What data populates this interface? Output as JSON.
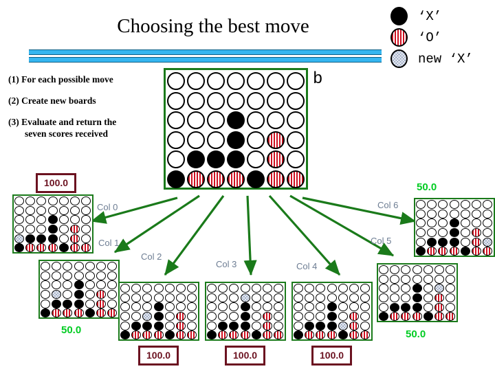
{
  "slide": {
    "title": "Choosing the best move",
    "board_label": "b"
  },
  "steps": [
    {
      "num": "(1)",
      "text": "For each possible move",
      "cont": ""
    },
    {
      "num": "(2)",
      "text": "Create new boards",
      "cont": ""
    },
    {
      "num": "(3)",
      "text": "Evaluate and return the",
      "cont": "seven scores received"
    }
  ],
  "legend": {
    "items": [
      {
        "icon": "black-disc-icon",
        "kind": "x",
        "label": "‘X’"
      },
      {
        "icon": "striped-disc-icon",
        "kind": "o",
        "label": "‘O’"
      },
      {
        "icon": "hatched-disc-icon",
        "kind": "new",
        "label": "new ‘X’"
      }
    ]
  },
  "colors": {
    "board_border": "#1a7a1a",
    "arrow": "#1a7a1a",
    "score_box_border": "#6b1220",
    "score_box_text": "#6b1220",
    "score_green": "#00cc22",
    "col_label": "#6d7d93",
    "rule_fill": "#35b6f0",
    "piece_x": "#000000",
    "piece_o": "#cf1020",
    "piece_new": "#9aa9c4"
  },
  "main_board": {
    "rows": 6,
    "cols": 7,
    "legend_key": {
      "e": "empty",
      "x": "black 'X'",
      "o": "red striped 'O'",
      "n": "new 'X'"
    },
    "grid": [
      [
        "e",
        "e",
        "e",
        "e",
        "e",
        "e",
        "e"
      ],
      [
        "e",
        "e",
        "e",
        "e",
        "e",
        "e",
        "e"
      ],
      [
        "e",
        "e",
        "e",
        "x",
        "e",
        "e",
        "e"
      ],
      [
        "e",
        "e",
        "e",
        "x",
        "e",
        "o",
        "e"
      ],
      [
        "e",
        "x",
        "x",
        "x",
        "e",
        "o",
        "e"
      ],
      [
        "x",
        "o",
        "o",
        "o",
        "x",
        "o",
        "o"
      ]
    ]
  },
  "branches": [
    {
      "id": "col0",
      "col_label": "Col 0",
      "score": "100.0",
      "score_style": "box",
      "score_position": "above",
      "grid": [
        [
          "e",
          "e",
          "e",
          "e",
          "e",
          "e",
          "e"
        ],
        [
          "e",
          "e",
          "e",
          "e",
          "e",
          "e",
          "e"
        ],
        [
          "e",
          "e",
          "e",
          "x",
          "e",
          "e",
          "e"
        ],
        [
          "e",
          "e",
          "e",
          "x",
          "e",
          "o",
          "e"
        ],
        [
          "n",
          "x",
          "x",
          "x",
          "e",
          "o",
          "e"
        ],
        [
          "x",
          "o",
          "o",
          "o",
          "x",
          "o",
          "o"
        ]
      ]
    },
    {
      "id": "col1",
      "col_label": "Col 1",
      "score": "50.0",
      "score_style": "green",
      "score_position": "below",
      "grid": [
        [
          "e",
          "e",
          "e",
          "e",
          "e",
          "e",
          "e"
        ],
        [
          "e",
          "e",
          "e",
          "e",
          "e",
          "e",
          "e"
        ],
        [
          "e",
          "e",
          "e",
          "x",
          "e",
          "e",
          "e"
        ],
        [
          "e",
          "n",
          "e",
          "x",
          "e",
          "o",
          "e"
        ],
        [
          "e",
          "x",
          "x",
          "x",
          "e",
          "o",
          "e"
        ],
        [
          "x",
          "o",
          "o",
          "o",
          "x",
          "o",
          "o"
        ]
      ]
    },
    {
      "id": "col2",
      "col_label": "Col 2",
      "score": "100.0",
      "score_style": "box",
      "score_position": "below",
      "grid": [
        [
          "e",
          "e",
          "e",
          "e",
          "e",
          "e",
          "e"
        ],
        [
          "e",
          "e",
          "e",
          "e",
          "e",
          "e",
          "e"
        ],
        [
          "e",
          "e",
          "e",
          "x",
          "e",
          "e",
          "e"
        ],
        [
          "e",
          "e",
          "n",
          "x",
          "e",
          "o",
          "e"
        ],
        [
          "e",
          "x",
          "x",
          "x",
          "e",
          "o",
          "e"
        ],
        [
          "x",
          "o",
          "o",
          "o",
          "x",
          "o",
          "o"
        ]
      ]
    },
    {
      "id": "col3",
      "col_label": "Col 3",
      "score": "100.0",
      "score_style": "box",
      "score_position": "below",
      "grid": [
        [
          "e",
          "e",
          "e",
          "e",
          "e",
          "e",
          "e"
        ],
        [
          "e",
          "e",
          "e",
          "n",
          "e",
          "e",
          "e"
        ],
        [
          "e",
          "e",
          "e",
          "x",
          "e",
          "e",
          "e"
        ],
        [
          "e",
          "e",
          "e",
          "x",
          "e",
          "o",
          "e"
        ],
        [
          "e",
          "x",
          "x",
          "x",
          "e",
          "o",
          "e"
        ],
        [
          "x",
          "o",
          "o",
          "o",
          "x",
          "o",
          "o"
        ]
      ]
    },
    {
      "id": "col4",
      "col_label": "Col 4",
      "score": "100.0",
      "score_style": "box",
      "score_position": "below",
      "grid": [
        [
          "e",
          "e",
          "e",
          "e",
          "e",
          "e",
          "e"
        ],
        [
          "e",
          "e",
          "e",
          "e",
          "e",
          "e",
          "e"
        ],
        [
          "e",
          "e",
          "e",
          "x",
          "e",
          "e",
          "e"
        ],
        [
          "e",
          "e",
          "e",
          "x",
          "e",
          "o",
          "e"
        ],
        [
          "e",
          "x",
          "x",
          "x",
          "n",
          "o",
          "e"
        ],
        [
          "x",
          "o",
          "o",
          "o",
          "x",
          "o",
          "o"
        ]
      ]
    },
    {
      "id": "col5",
      "col_label": "Col 5",
      "score": "50.0",
      "score_style": "green",
      "score_position": "below",
      "grid": [
        [
          "e",
          "e",
          "e",
          "e",
          "e",
          "e",
          "e"
        ],
        [
          "e",
          "e",
          "e",
          "e",
          "e",
          "e",
          "e"
        ],
        [
          "e",
          "e",
          "e",
          "x",
          "e",
          "n",
          "e"
        ],
        [
          "e",
          "e",
          "e",
          "x",
          "e",
          "o",
          "e"
        ],
        [
          "e",
          "x",
          "x",
          "x",
          "e",
          "o",
          "e"
        ],
        [
          "x",
          "o",
          "o",
          "o",
          "x",
          "o",
          "o"
        ]
      ]
    },
    {
      "id": "col6",
      "col_label": "Col 6",
      "score": "50.0",
      "score_style": "green",
      "score_position": "above",
      "grid": [
        [
          "e",
          "e",
          "e",
          "e",
          "e",
          "e",
          "e"
        ],
        [
          "e",
          "e",
          "e",
          "e",
          "e",
          "e",
          "e"
        ],
        [
          "e",
          "e",
          "e",
          "x",
          "e",
          "e",
          "e"
        ],
        [
          "e",
          "e",
          "e",
          "x",
          "e",
          "o",
          "e"
        ],
        [
          "e",
          "x",
          "x",
          "x",
          "e",
          "o",
          "n"
        ],
        [
          "x",
          "o",
          "o",
          "o",
          "x",
          "o",
          "o"
        ]
      ]
    }
  ]
}
